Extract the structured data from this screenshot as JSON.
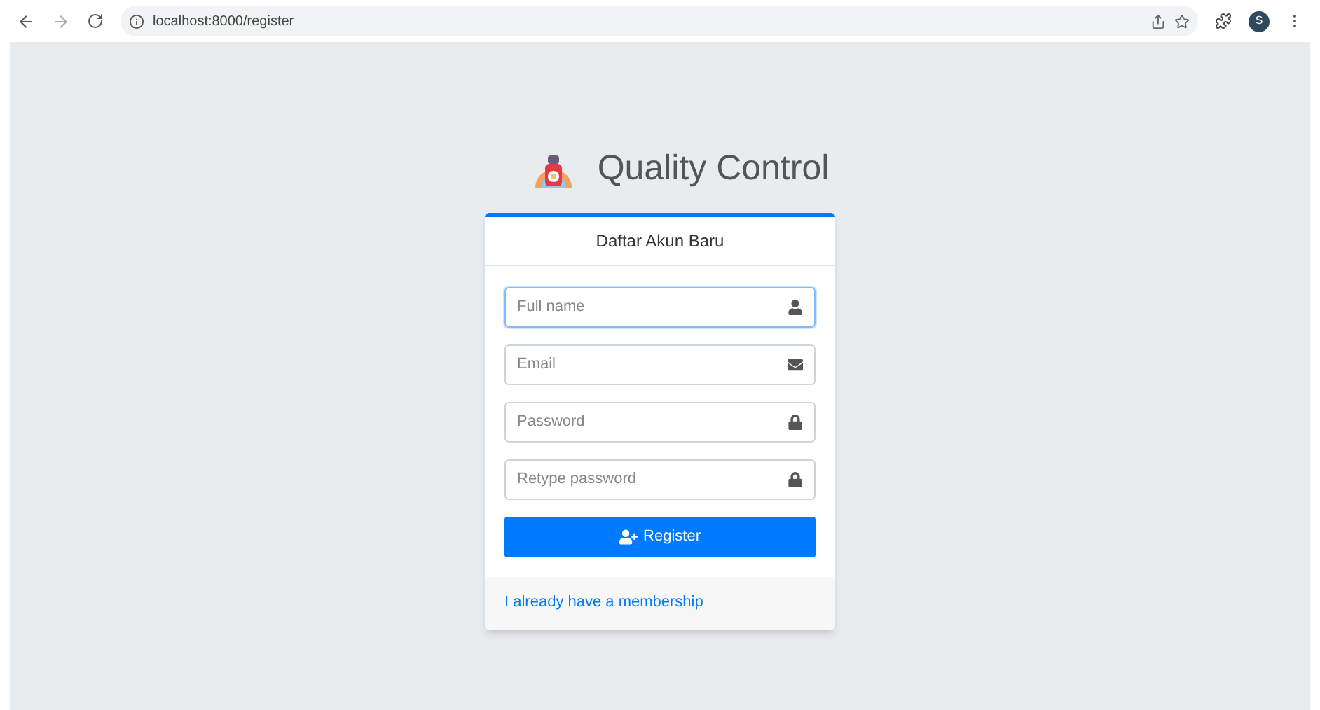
{
  "browser": {
    "url": "localhost:8000/register",
    "avatar": "S"
  },
  "brand": {
    "title": "Quality Control"
  },
  "card": {
    "header": "Daftar Akun Baru",
    "fields": [
      {
        "placeholder": "Full name",
        "kind": "name",
        "focused": true
      },
      {
        "placeholder": "Email",
        "kind": "email",
        "focused": false
      },
      {
        "placeholder": "Password",
        "kind": "password",
        "focused": false
      },
      {
        "placeholder": "Retype password",
        "kind": "password",
        "focused": false
      }
    ],
    "button": "Register",
    "link": "I already have a membership"
  }
}
